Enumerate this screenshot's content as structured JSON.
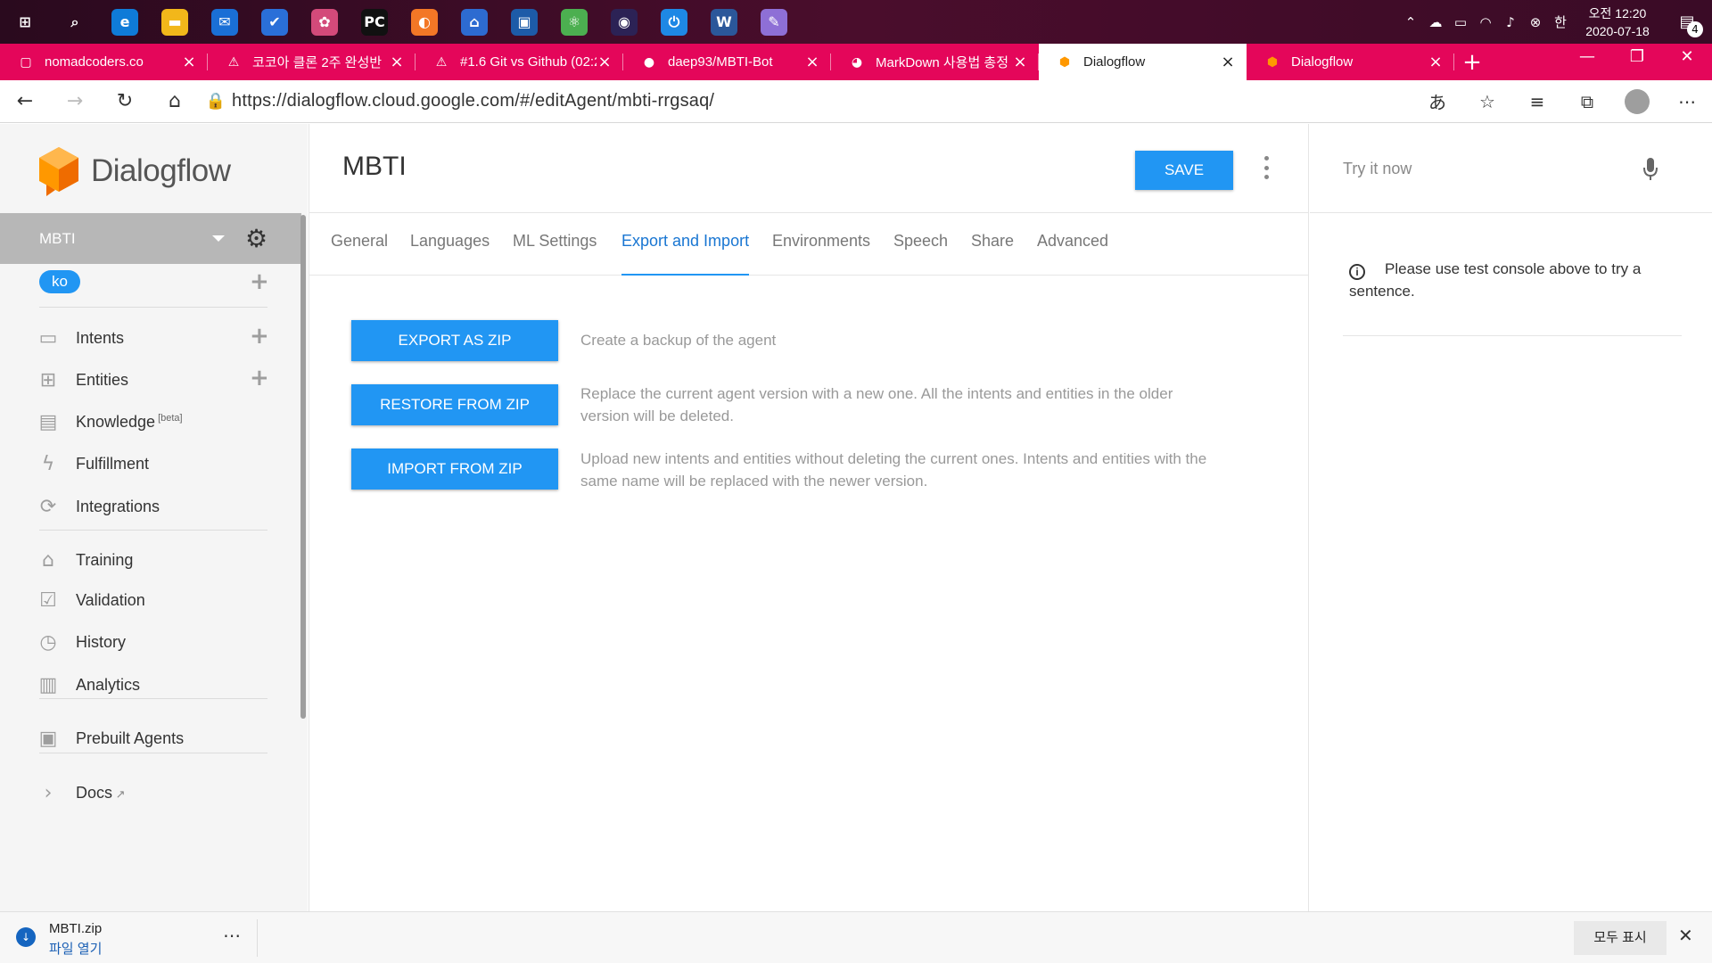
{
  "taskbar": {
    "apps": [
      {
        "name": "windows-start-icon",
        "glyph": "⊞",
        "color": "transparent"
      },
      {
        "name": "search-icon",
        "glyph": "⌕",
        "color": "transparent"
      },
      {
        "name": "edge-browser-icon",
        "glyph": "e",
        "color": "#0f7bd8"
      },
      {
        "name": "file-explorer-icon",
        "glyph": "▬",
        "color": "#f2b71a"
      },
      {
        "name": "mail-icon",
        "glyph": "✉",
        "color": "#1a6fd6"
      },
      {
        "name": "todo-icon",
        "glyph": "✔",
        "color": "#2a6fd8"
      },
      {
        "name": "pinwheel-app-icon",
        "glyph": "✿",
        "color": "#d34a7a"
      },
      {
        "name": "pycharm-icon",
        "glyph": "PC",
        "color": "#111111"
      },
      {
        "name": "jupyter-icon",
        "glyph": "◐",
        "color": "#f37726"
      },
      {
        "name": "network-app-icon",
        "glyph": "⌂",
        "color": "#2d6bd1"
      },
      {
        "name": "virtualbox-icon",
        "glyph": "▣",
        "color": "#1d5ba8"
      },
      {
        "name": "atom-app-icon",
        "glyph": "⚛",
        "color": "#4caf50"
      },
      {
        "name": "eclipse-icon",
        "glyph": "◉",
        "color": "#2c2255"
      },
      {
        "name": "power-app-icon",
        "glyph": "⏻",
        "color": "#1e88e5"
      },
      {
        "name": "word-icon",
        "glyph": "W",
        "color": "#2b579a"
      },
      {
        "name": "paint-app-icon",
        "glyph": "✎",
        "color": "#8e6fd6"
      }
    ],
    "tray": {
      "ime": "한",
      "clock_top": "오전 12:20",
      "clock_bottom": "2020-07-18",
      "notification_count": "4"
    }
  },
  "browser": {
    "tabs": [
      {
        "title": "nomadcoders.co",
        "favicon": "▢",
        "active": false
      },
      {
        "title": "코코아 클론 2주 완성반",
        "favicon": "⚠",
        "active": false
      },
      {
        "title": "#1.6 Git vs Github (02:2",
        "favicon": "⚠",
        "active": false
      },
      {
        "title": "daep93/MBTI-Bot",
        "favicon": "●",
        "active": false
      },
      {
        "title": "MarkDown 사용법 총정",
        "favicon": "◕",
        "active": false
      },
      {
        "title": "Dialogflow",
        "favicon": "⬢",
        "active": true
      },
      {
        "title": "Dialogflow",
        "favicon": "⬢",
        "active": false
      }
    ],
    "url": "https://dialogflow.cloud.google.com/#/editAgent/mbti-rrgsaq/"
  },
  "sidebar": {
    "brand": "Dialogflow",
    "agent_name": "MBTI",
    "language": "ko",
    "items": [
      {
        "label": "Intents",
        "icon": "intents-icon",
        "glyph": "▭",
        "has_add": true
      },
      {
        "label": "Entities",
        "icon": "entities-icon",
        "glyph": "⊞",
        "has_add": true
      },
      {
        "label": "Knowledge",
        "sup": "[beta]",
        "icon": "knowledge-icon",
        "glyph": "▤",
        "has_add": false
      },
      {
        "label": "Fulfillment",
        "icon": "fulfillment-icon",
        "glyph": "ϟ",
        "has_add": false
      },
      {
        "label": "Integrations",
        "icon": "integrations-icon",
        "glyph": "⟳",
        "has_add": false
      },
      {
        "label": "Training",
        "icon": "training-icon",
        "glyph": "⌂",
        "has_add": false
      },
      {
        "label": "Validation",
        "icon": "validation-icon",
        "glyph": "☑",
        "has_add": false
      },
      {
        "label": "History",
        "icon": "history-icon",
        "glyph": "◷",
        "has_add": false
      },
      {
        "label": "Analytics",
        "icon": "analytics-icon",
        "glyph": "▥",
        "has_add": false
      },
      {
        "label": "Prebuilt Agents",
        "icon": "prebuilt-agents-icon",
        "glyph": "▣",
        "has_add": false
      },
      {
        "label": "Docs",
        "icon": "docs-icon",
        "glyph": "›",
        "has_add": false
      }
    ]
  },
  "main": {
    "title": "MBTI",
    "save_label": "SAVE",
    "tabs": [
      {
        "label": "General",
        "active": false
      },
      {
        "label": "Languages",
        "active": false
      },
      {
        "label": "ML Settings",
        "active": false
      },
      {
        "label": "Export and Import",
        "active": true
      },
      {
        "label": "Environments",
        "active": false
      },
      {
        "label": "Speech",
        "active": false
      },
      {
        "label": "Share",
        "active": false
      },
      {
        "label": "Advanced",
        "active": false
      }
    ],
    "actions": [
      {
        "label": "EXPORT AS ZIP",
        "description": "Create a backup of the agent"
      },
      {
        "label": "RESTORE FROM ZIP",
        "description": "Replace the current agent version with a new one. All the intents and entities in the older version will be deleted."
      },
      {
        "label": "IMPORT FROM ZIP",
        "description": "Upload new intents and entities without deleting the current ones. Intents and entities with the same name will be replaced with the newer version."
      }
    ]
  },
  "try_it": {
    "placeholder": "Try it now",
    "message": "Please use test console above to try a sentence."
  },
  "downloads": {
    "file_name": "MBTI.zip",
    "open_label": "파일 열기",
    "show_all_label": "모두 표시"
  },
  "colors": {
    "accent": "#2196f3",
    "tab_bar": "#e4065a",
    "logo_orange": "#ff9800"
  }
}
